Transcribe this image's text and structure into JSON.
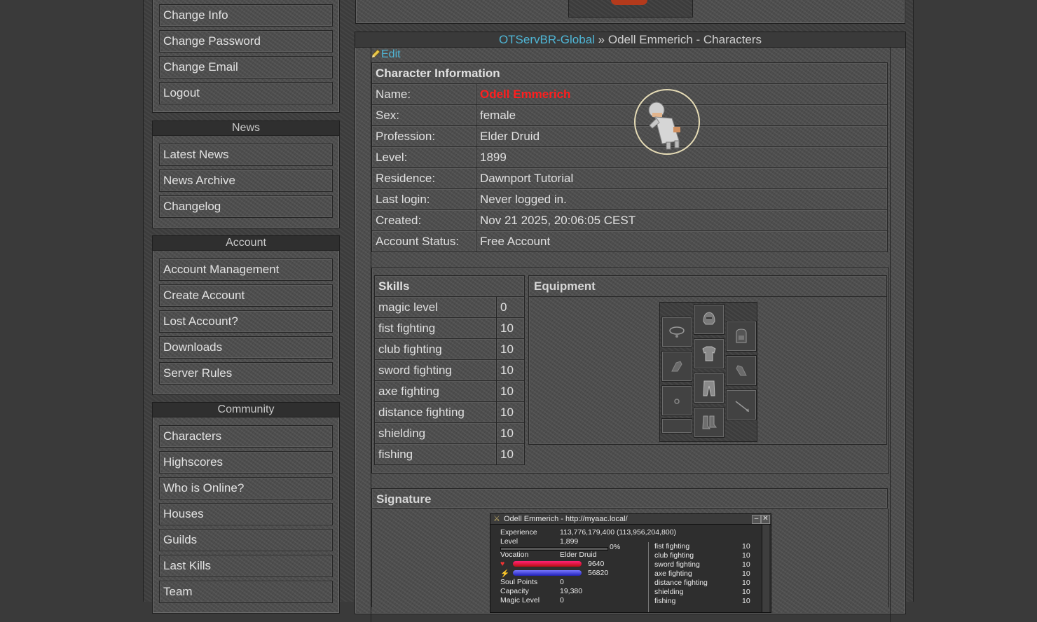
{
  "sidebar": {
    "account_top_items": [
      "Change Info",
      "Change Password",
      "Change Email",
      "Logout"
    ],
    "news": {
      "title": "News",
      "items": [
        "Latest News",
        "News Archive",
        "Changelog"
      ]
    },
    "account": {
      "title": "Account",
      "items": [
        "Account Management",
        "Create Account",
        "Lost Account?",
        "Downloads",
        "Server Rules"
      ]
    },
    "community": {
      "title": "Community",
      "items": [
        "Characters",
        "Highscores",
        "Who is Online?",
        "Houses",
        "Guilds",
        "Last Kills",
        "Team"
      ]
    }
  },
  "breadcrumb": {
    "link": "OTServBR-Global",
    "separator": "»",
    "rest": "Odell Emmerich - Characters"
  },
  "edit_label": "Edit",
  "character": {
    "header": "Character Information",
    "rows": [
      {
        "label": "Name:",
        "value": "Odell Emmerich"
      },
      {
        "label": "Sex:",
        "value": "female"
      },
      {
        "label": "Profession:",
        "value": "Elder Druid"
      },
      {
        "label": "Level:",
        "value": "1899"
      },
      {
        "label": "Residence:",
        "value": "Dawnport Tutorial"
      },
      {
        "label": "Last login:",
        "value": "Never logged in."
      },
      {
        "label": "Created:",
        "value": "Nov 21 2025, 20:06:05 CEST"
      },
      {
        "label": "Account Status:",
        "value": "Free Account"
      }
    ],
    "name_color": "#ff1e1e"
  },
  "skills": {
    "header": "Skills",
    "rows": [
      {
        "name": "magic level",
        "value": "0"
      },
      {
        "name": "fist fighting",
        "value": "10"
      },
      {
        "name": "club fighting",
        "value": "10"
      },
      {
        "name": "sword fighting",
        "value": "10"
      },
      {
        "name": "axe fighting",
        "value": "10"
      },
      {
        "name": "distance fighting",
        "value": "10"
      },
      {
        "name": "shielding",
        "value": "10"
      },
      {
        "name": "fishing",
        "value": "10"
      }
    ]
  },
  "equipment": {
    "header": "Equipment",
    "slots": [
      "amulet-icon",
      "helmet-icon",
      "backpack-icon",
      "left-hand-icon",
      "armor-icon",
      "right-hand-icon",
      "ring-icon",
      "legs-icon",
      "ammo-icon",
      "boots-icon"
    ]
  },
  "signature": {
    "header": "Signature",
    "title": "Odell Emmerich - http://myaac.local/",
    "experience_label": "Experience",
    "experience_value": "113,776,179,400 (113,956,204,800)",
    "level_label": "Level",
    "level_value": "1,899",
    "level_percent": "0%",
    "vocation_label": "Vocation",
    "vocation_value": "Elder Druid",
    "health": "9640",
    "mana": "56820",
    "soul_label": "Soul Points",
    "soul_value": "0",
    "capacity_label": "Capacity",
    "capacity_value": "19,380",
    "magic_label": "Magic Level",
    "magic_value": "0",
    "skills": [
      {
        "name": "fist fighting",
        "value": "10"
      },
      {
        "name": "club fighting",
        "value": "10"
      },
      {
        "name": "sword fighting",
        "value": "10"
      },
      {
        "name": "axe fighting",
        "value": "10"
      },
      {
        "name": "distance fighting",
        "value": "10"
      },
      {
        "name": "shielding",
        "value": "10"
      },
      {
        "name": "fishing",
        "value": "10"
      }
    ]
  }
}
